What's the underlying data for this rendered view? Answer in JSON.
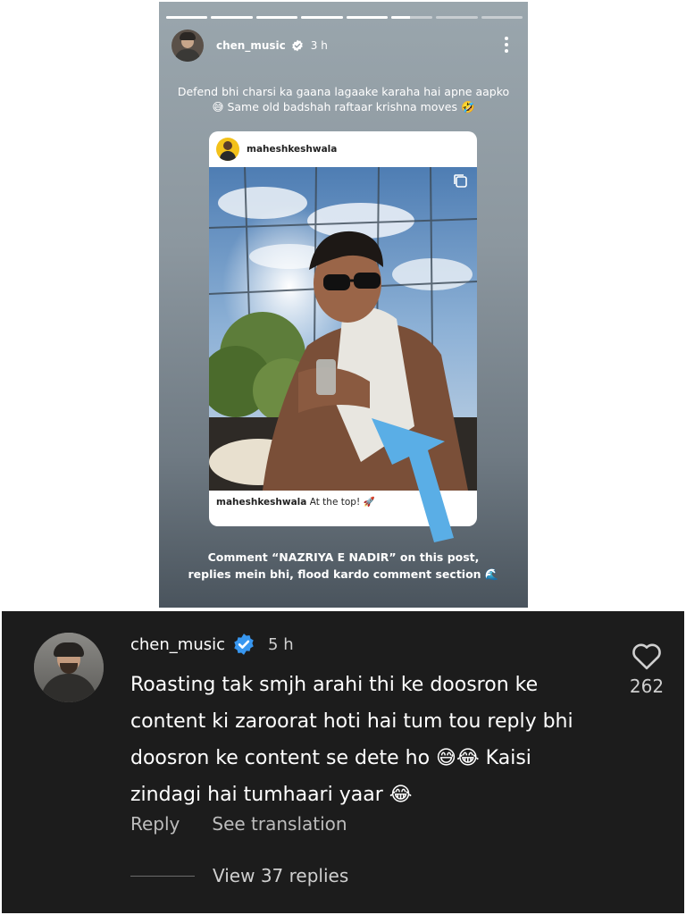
{
  "story": {
    "progress": [
      1,
      1,
      1,
      1,
      1,
      0.45,
      0,
      0
    ],
    "username": "chen_music",
    "time": "3 h",
    "caption": "Defend bhi charsi ka gaana lagaake karaha hai apne aapko 😅 Same old badshah raftaar krishna moves 🤣",
    "post": {
      "username": "maheshkeshwala",
      "caption_user": "maheshkeshwala",
      "caption_text": "At the top! 🚀"
    },
    "cta_line1": "Comment “NAZRIYA E NADIR” on this post,",
    "cta_line2": "replies mein bhi, flood kardo comment section 🌊"
  },
  "comment": {
    "username": "chen_music",
    "time": "5 h",
    "text": "Roasting tak smjh arahi thi ke doosron ke content ki zaroorat hoti hai tum tou reply bhi doosron ke content se dete ho 😅😂 Kaisi zindagi hai tumhaari yaar 😂",
    "reply_label": "Reply",
    "translate_label": "See translation",
    "view_replies_label": "View 37 replies",
    "like_count": "262"
  },
  "colors": {
    "verified": "#3897f0",
    "arrow": "#5aaee6",
    "comment_bg": "#1c1c1c"
  },
  "icons": [
    "verified-badge-icon",
    "more-options-icon",
    "heart-icon",
    "arrow-sticker-icon"
  ]
}
